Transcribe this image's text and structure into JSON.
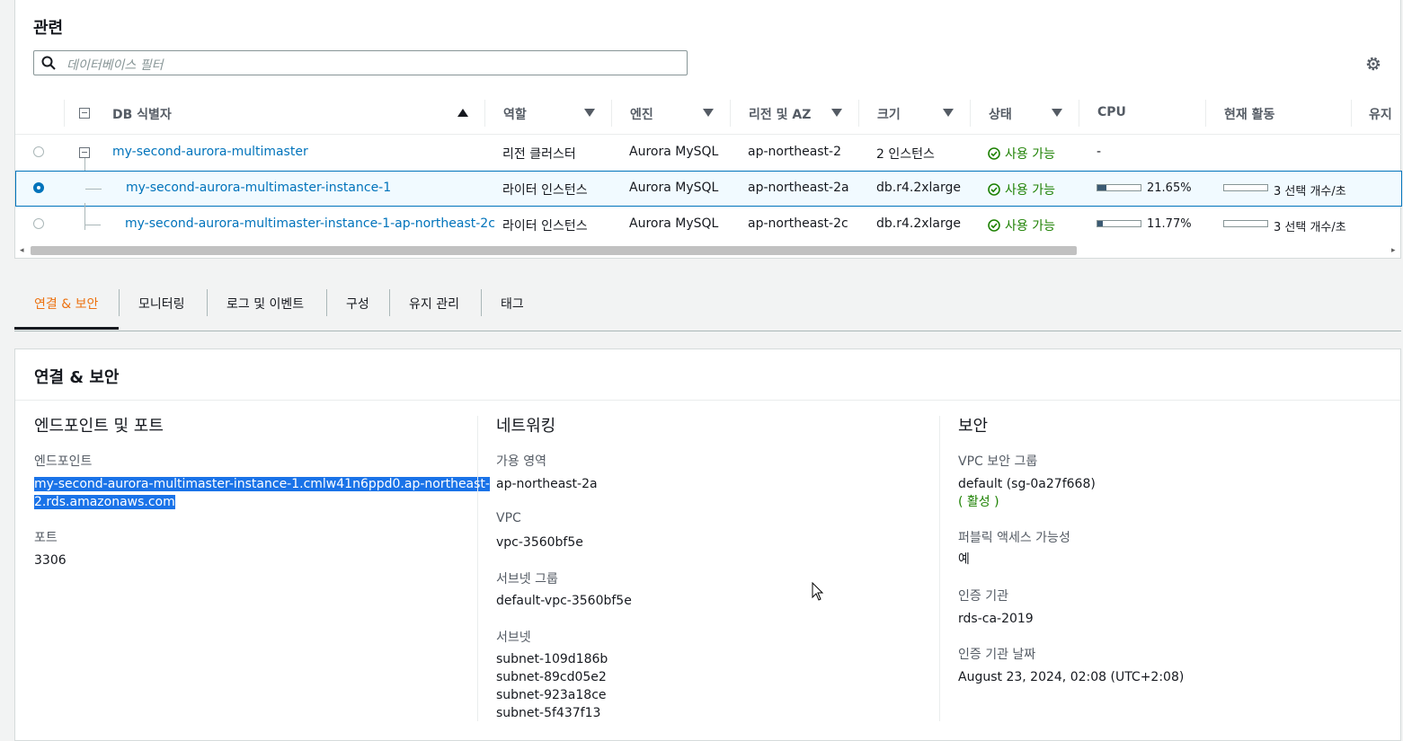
{
  "related": {
    "title": "관련",
    "search_placeholder": "데이터베이스 필터"
  },
  "table": {
    "headers": {
      "db_identifier": "DB 식별자",
      "role": "역할",
      "engine": "엔진",
      "region_az": "리전 및 AZ",
      "size": "크기",
      "status": "상태",
      "cpu": "CPU",
      "activity": "현재 활동",
      "maint": "유지"
    },
    "rows": [
      {
        "id": "my-second-aurora-multimaster",
        "role": "리전 클러스터",
        "engine": "Aurora MySQL",
        "region": "ap-northeast-2",
        "size": "2 인스턴스",
        "status": "사용 가능",
        "cpu": "-",
        "activity": "",
        "selected": false
      },
      {
        "id": "my-second-aurora-multimaster-instance-1",
        "role": "라이터 인스턴스",
        "engine": "Aurora MySQL",
        "region": "ap-northeast-2a",
        "size": "db.r4.2xlarge",
        "status": "사용 가능",
        "cpu": "21.65%",
        "cpu_fraction": 0.2165,
        "activity": "3 선택 개수/초",
        "selected": true
      },
      {
        "id": "my-second-aurora-multimaster-instance-1-ap-northeast-2c",
        "role": "라이터 인스턴스",
        "engine": "Aurora MySQL",
        "region": "ap-northeast-2c",
        "size": "db.r4.2xlarge",
        "status": "사용 가능",
        "cpu": "11.77%",
        "cpu_fraction": 0.1177,
        "activity": "3 선택 개수/초",
        "selected": false
      }
    ]
  },
  "tabs": [
    "연결 & 보안",
    "모니터링",
    "로그 및 이벤트",
    "구성",
    "유지 관리",
    "태그"
  ],
  "details": {
    "title": "연결 & 보안",
    "endpoint_col": {
      "heading": "엔드포인트 및 포트",
      "endpoint_label": "엔드포인트",
      "endpoint_line1": "my-second-aurora-multimaster-instance-1.cmlw41n6ppd0.ap-northeast-",
      "endpoint_line2": "2.rds.amazonaws.com",
      "port_label": "포트",
      "port": "3306"
    },
    "network_col": {
      "heading": "네트워킹",
      "az_label": "가용 영역",
      "az": "ap-northeast-2a",
      "vpc_label": "VPC",
      "vpc": "vpc-3560bf5e",
      "subnet_group_label": "서브넷 그룹",
      "subnet_group": "default-vpc-3560bf5e",
      "subnets_label": "서브넷",
      "subnets": [
        "subnet-109d186b",
        "subnet-89cd05e2",
        "subnet-923a18ce",
        "subnet-5f437f13"
      ]
    },
    "security_col": {
      "heading": "보안",
      "sg_label": "VPC 보안 그룹",
      "sg": "default (sg-0a27f668)",
      "sg_state": "( 활성 )",
      "public_label": "퍼블릭 액세스 가능성",
      "public": "예",
      "ca_label": "인증 기관",
      "ca": "rds-ca-2019",
      "ca_date_label": "인증 기관 날짜",
      "ca_date": "August 23, 2024, 02:08 (UTC+2:08)"
    }
  },
  "colors": {
    "link": "#0073bb",
    "status_ok": "#1d8102",
    "tab_active": "#ec7211",
    "highlight": "#1a73e8"
  }
}
